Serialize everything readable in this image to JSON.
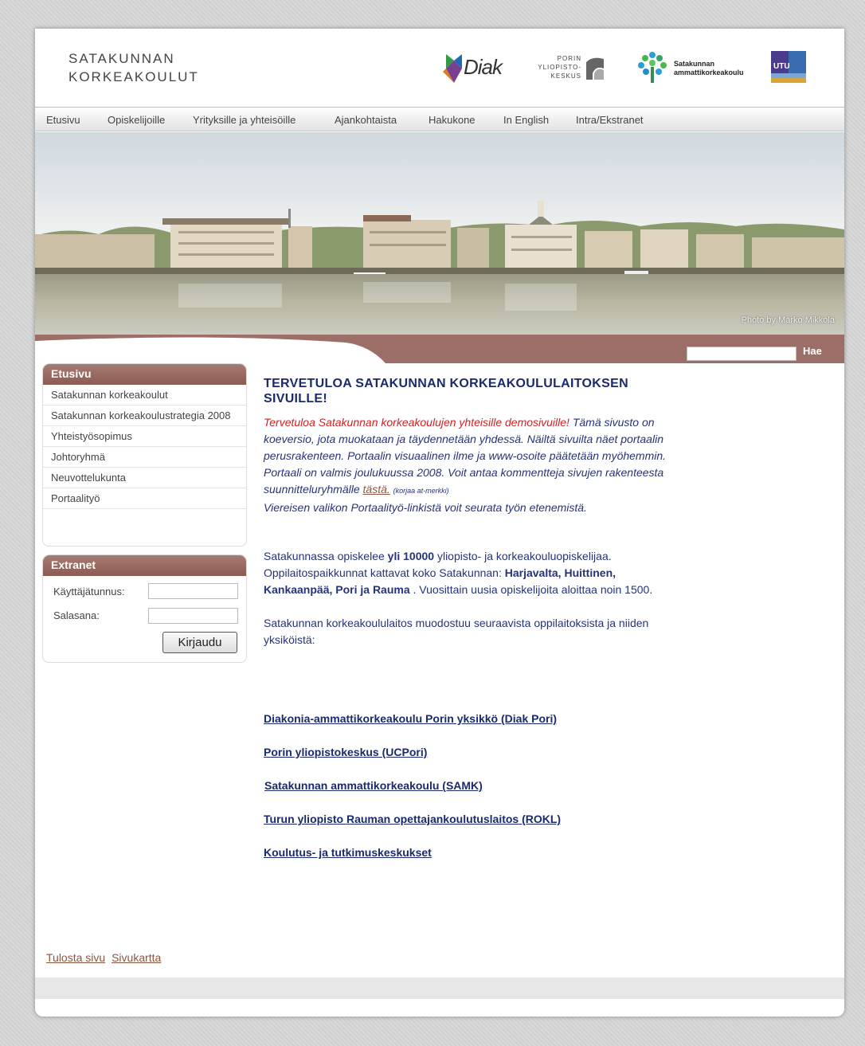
{
  "brand": {
    "line1": "SATAKUNNAN",
    "line2": "KORKEAKOULUT"
  },
  "logos": {
    "diak": "Diak",
    "porin": [
      "PORIN",
      "YLIOPISTO-",
      "KESKUS"
    ],
    "samk": [
      "Satakunnan",
      "ammattikorkeakoulu"
    ],
    "utu": "UTU"
  },
  "nav": [
    "Etusivu",
    "Opiskelijoille",
    "Yrityksille ja yhteisöille",
    "Ajankohtaista",
    "Hakukone",
    "In English",
    "Intra/Ekstranet"
  ],
  "hero": {
    "credit": "Photo by Marko Mikkola"
  },
  "search": {
    "button": "Hae"
  },
  "sidebar": {
    "title": "Etusivu",
    "items": [
      "Satakunnan korkeakoulut",
      "Satakunnan korkeakoulustrategia 2008",
      "Yhteistyösopimus",
      "Johtoryhmä",
      "Neuvottelukunta",
      "Portaalityö"
    ]
  },
  "extranet": {
    "title": "Extranet",
    "user_label": "Käyttäjätunnus:",
    "pass_label": "Salasana:",
    "login": "Kirjaudu"
  },
  "content": {
    "title": "TERVETULOA SATAKUNNAN KORKEAKOULULAITOKSEN SIVUILLE!",
    "intro_red": "Tervetuloa Satakunnan korkeakoulujen yhteisille demosivuille!",
    "intro_rest": "Tämä sivusto on koeversio, jota muokataan ja täydennetään yhdessä.  Näiltä sivuilta näet portaalin perusrakenteen. Portaalin visuaalinen ilme ja www-osoite päätetään myöhemmin. Portaali on valmis joulukuussa 2008. Voit antaa kommentteja sivujen rakenteesta suunnitteluryhmälle",
    "intro_link": "tästä.",
    "intro_small": "(korjaa at-merkki)",
    "intro_end": "Viereisen valikon Portaalityö-linkistä voit seurata työn etenemistä.",
    "p1_a": "Satakunnassa opiskelee ",
    "p1_b": "yli 10000",
    "p1_c": " yliopisto- ja korkeakouluopiskelijaa. Oppilaitospaikkunnat kattavat koko Satakunnan: ",
    "p1_d": "Harjavalta, Huittinen, Kankaanpää, Pori ja Rauma",
    "p1_e": " . Vuosittain uusia opiskelijoita aloittaa noin 1500.",
    "p2": "Satakunnan korkeakoululaitos muodostuu seuraavista oppilaitoksista ja niiden yksiköistä:",
    "links": [
      "Diakonia-ammattikorkeakoulu Porin yksikkö (Diak Pori)",
      "Porin yliopistokeskus (UCPori)",
      "Satakunnan ammattikorkeakoulu (SAMK)",
      "Turun yliopisto Rauman opettajankoulutuslaitos (ROKL)",
      "Koulutus- ja tutkimuskeskukset"
    ]
  },
  "footer": {
    "print": "Tulosta sivu",
    "sitemap": "Sivukartta"
  }
}
